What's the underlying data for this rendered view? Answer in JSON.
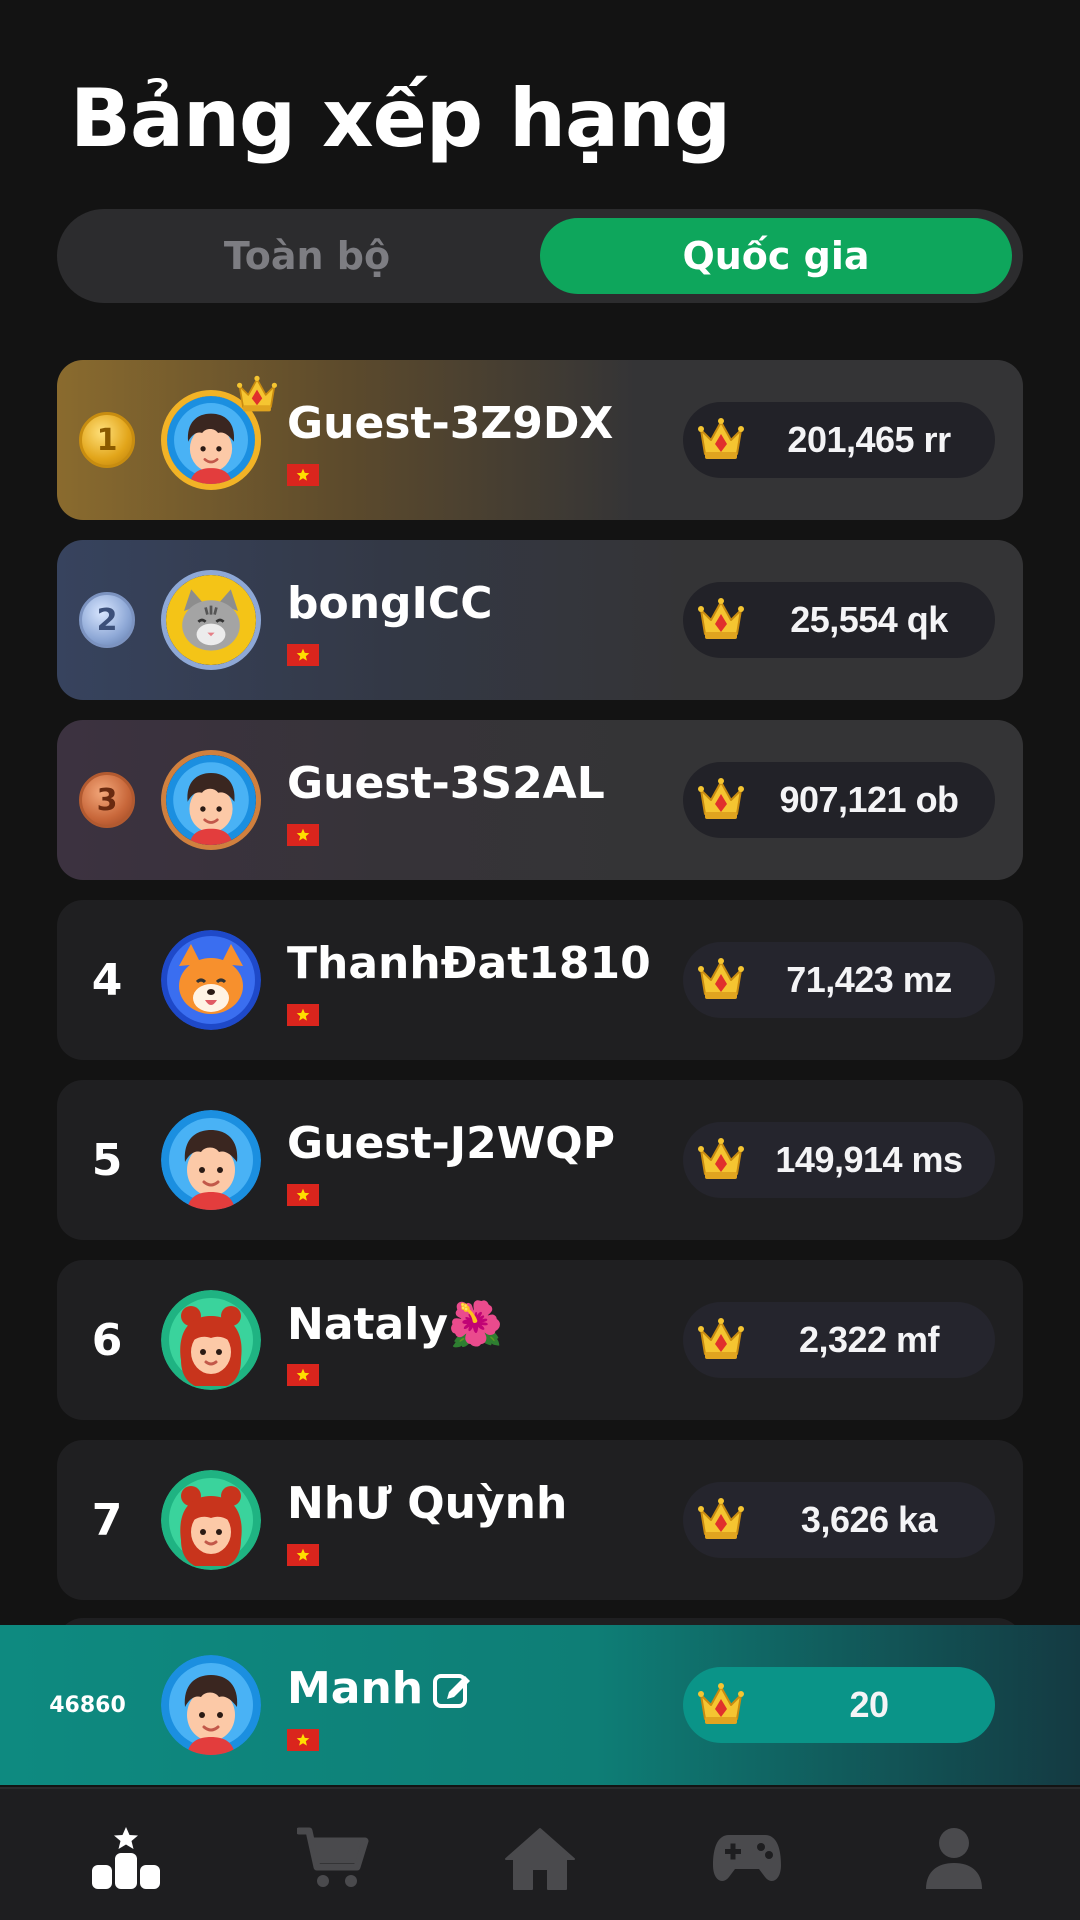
{
  "header": {
    "title": "Bảng xếp hạng"
  },
  "tabs": [
    {
      "label": "Toàn bộ",
      "active": false
    },
    {
      "label": "Quốc gia",
      "active": true
    }
  ],
  "colors": {
    "accent": "#0ea65c",
    "me_row": "#0e8a80",
    "gold": "#e2a51a",
    "silver": "#8ea8d6",
    "bronze": "#c8673a"
  },
  "leaderboard": [
    {
      "rank": "1",
      "name": "Guest-3Z9DX",
      "score": "201,465 rr",
      "avatar": "boy-avatar-icon",
      "flag": "vietnam-flag-icon"
    },
    {
      "rank": "2",
      "name": "bongICC",
      "score": "25,554 qk",
      "avatar": "cat-avatar-icon",
      "flag": "vietnam-flag-icon"
    },
    {
      "rank": "3",
      "name": "Guest-3S2AL",
      "score": "907,121 ob",
      "avatar": "boy-avatar-icon",
      "flag": "vietnam-flag-icon"
    },
    {
      "rank": "4",
      "name": "ThanhĐat1810",
      "score": "71,423 mz",
      "avatar": "fox-avatar-icon",
      "flag": "vietnam-flag-icon"
    },
    {
      "rank": "5",
      "name": "Guest-J2WQP",
      "score": "149,914 ms",
      "avatar": "boy-avatar-icon",
      "flag": "vietnam-flag-icon"
    },
    {
      "rank": "6",
      "name": "Nataly🌺",
      "score": "2,322 mf",
      "avatar": "girl-avatar-icon",
      "flag": "vietnam-flag-icon"
    },
    {
      "rank": "7",
      "name": "NhƯ Quỳnh",
      "score": "3,626 ka",
      "avatar": "girl-avatar-icon",
      "flag": "vietnam-flag-icon"
    }
  ],
  "current_user": {
    "rank": "46860",
    "name": "Manh",
    "score": "20",
    "avatar": "boy-avatar-icon",
    "flag": "vietnam-flag-icon"
  },
  "bottom_nav": [
    {
      "icon": "leaderboard-icon",
      "active": true
    },
    {
      "icon": "shop-cart-icon",
      "active": false
    },
    {
      "icon": "home-icon",
      "active": false
    },
    {
      "icon": "gamepad-icon",
      "active": false
    },
    {
      "icon": "profile-icon",
      "active": false
    }
  ]
}
